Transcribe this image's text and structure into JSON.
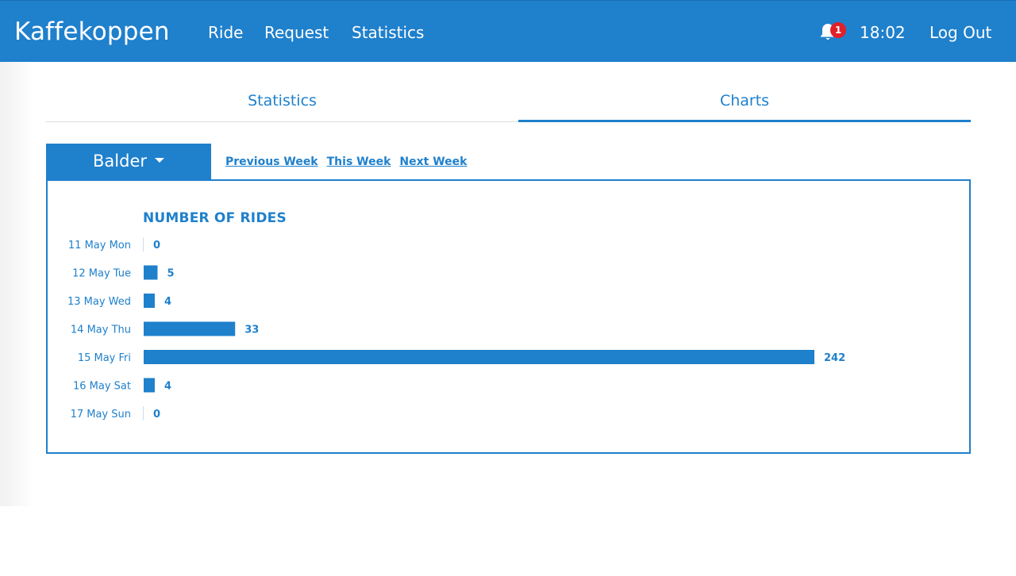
{
  "navbar": {
    "brand": "Kaffekoppen",
    "links": [
      "Ride",
      "Request",
      "Statistics"
    ],
    "notification_count": "1",
    "time": "18:02",
    "logout_label": "Log Out"
  },
  "tabs": [
    {
      "label": "Statistics",
      "active": false
    },
    {
      "label": "Charts",
      "active": true
    }
  ],
  "filters": {
    "selected": "Balder",
    "week_links": [
      "Previous Week",
      "This Week",
      "Next Week"
    ]
  },
  "colors": {
    "primary": "#1f80cc",
    "badge": "#e0202a"
  },
  "chart_data": {
    "type": "bar",
    "orientation": "horizontal",
    "title": "NUMBER OF RIDES",
    "categories": [
      "11 May Mon",
      "12 May Tue",
      "13 May Wed",
      "14 May Thu",
      "15 May Fri",
      "16 May Sat",
      "17 May Sun"
    ],
    "values": [
      0,
      5,
      4,
      33,
      242,
      4,
      0
    ],
    "data_labels": true,
    "grid": false,
    "xlim": [
      0,
      242
    ]
  }
}
